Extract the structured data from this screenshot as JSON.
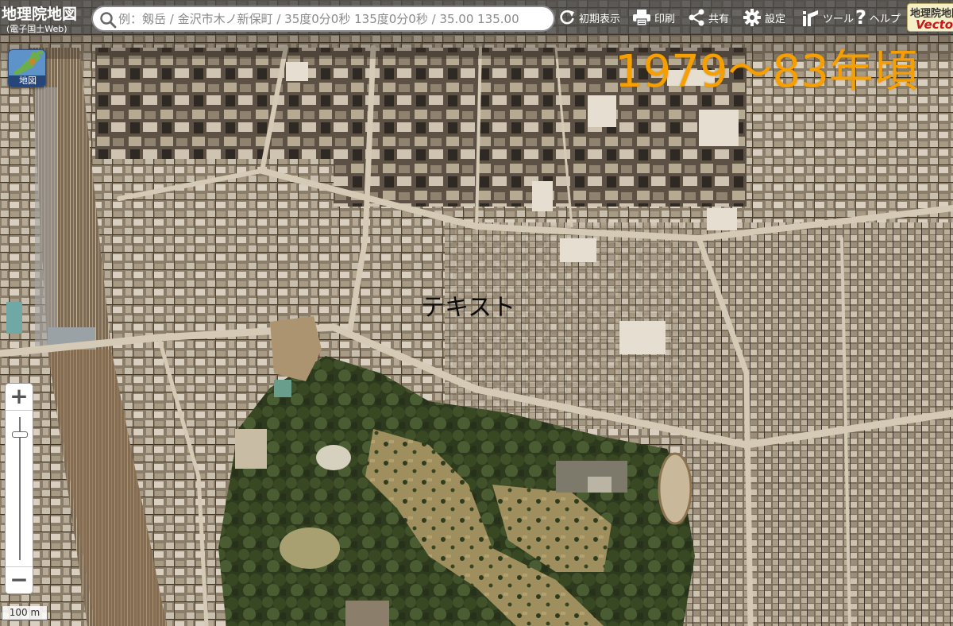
{
  "header": {
    "logo_title": "地理院地図",
    "logo_subtitle": "(電子国土Web)",
    "search": {
      "value": "",
      "placeholder": "例：剱岳 / 金沢市木ノ新保町 / 35度0分0秒 135度0分0秒 / 35.00 135.00"
    },
    "buttons": [
      {
        "label": "初期表示",
        "icon": "refresh-icon"
      },
      {
        "label": "印刷",
        "icon": "printer-icon"
      },
      {
        "label": "共有",
        "icon": "share-icon"
      },
      {
        "label": "設定",
        "icon": "gear-icon"
      },
      {
        "label": "ツール",
        "icon": "tool-icon"
      },
      {
        "label": "ヘルプ",
        "icon": "help-icon"
      }
    ],
    "badge": {
      "line1": "地理院地図",
      "line2": "Vector"
    }
  },
  "map": {
    "layer_button_label": "地図",
    "era_label": "1979〜83年頃",
    "map_text": "テキスト",
    "zoom": {
      "in_label": "+",
      "out_label": "−"
    },
    "scale_label": "100 m"
  },
  "colors": {
    "era_label": "#f5a000",
    "header_bg": "rgba(70,70,70,0.78)",
    "badge_accent": "#c8161d",
    "park_green": "#3a4a25",
    "lawn": "#9a8a58"
  }
}
